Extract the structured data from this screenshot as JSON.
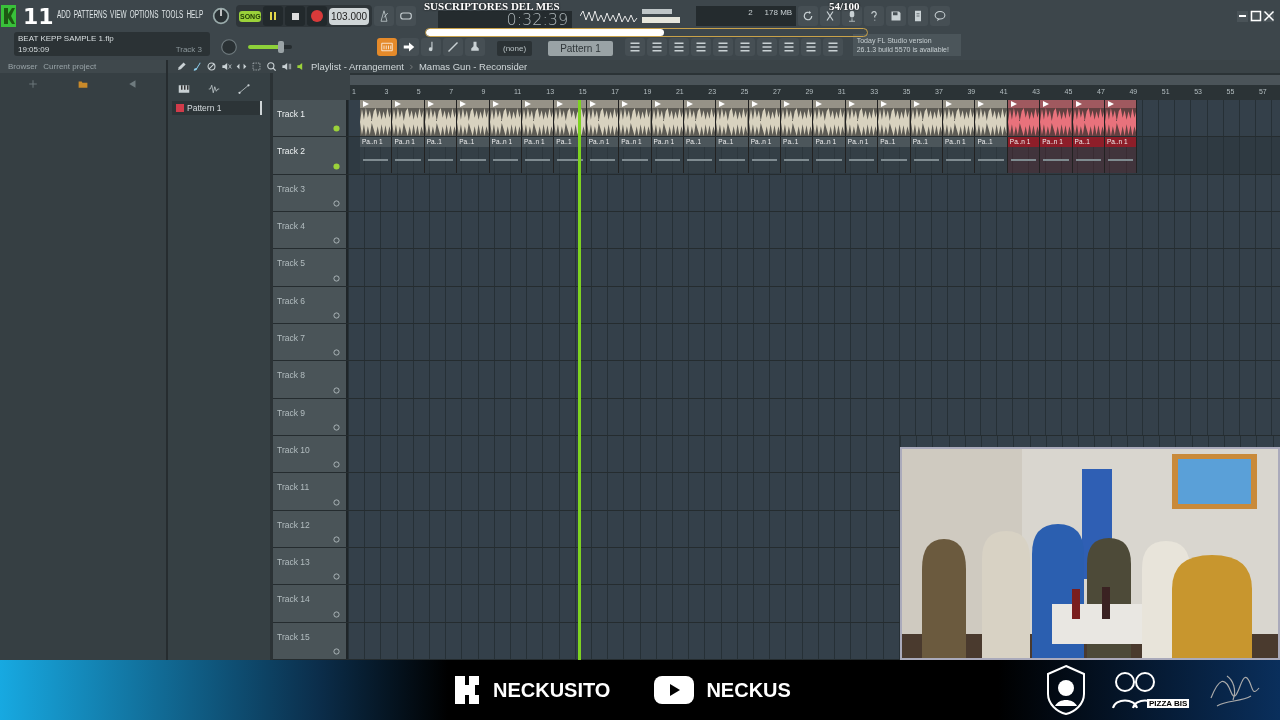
{
  "menu": {
    "badge": "11",
    "items": [
      "ADD",
      "PATTERNS",
      "VIEW",
      "OPTIONS",
      "TOOLS",
      "HELP"
    ]
  },
  "transport": {
    "song_mode": true,
    "mode_label": "SONG",
    "tempo": "103.000",
    "time": "0:32:39",
    "cpu": "2",
    "memory": "178 MB"
  },
  "subscriber_goal": {
    "title": "SUSCRIPTORES DEL MES",
    "count": "54/100",
    "level": 0.54
  },
  "project": {
    "file": "BEAT KEPP SAMPLE 1.flp",
    "time": "19:05:09",
    "hint": "Track 3"
  },
  "master_volume": {
    "level": 0.75
  },
  "pattern_selector": {
    "channel": "(none)",
    "pattern": "Pattern 1"
  },
  "news": {
    "lines": [
      "Today  FL Studio version",
      "26.1.3 build 5570 is available!"
    ]
  },
  "browser": {
    "tabs": [
      "Browser",
      "Current project"
    ]
  },
  "picker": {
    "items": [
      {
        "label": "Pattern 1",
        "selected": true
      }
    ]
  },
  "playlist": {
    "breadcrumb": [
      "Playlist - Arrangement",
      "Mamas Gun - Reconsider"
    ],
    "ruler": [
      "1",
      "3",
      "5",
      "7",
      "9",
      "11",
      "13",
      "15",
      "17",
      "19",
      "21",
      "23",
      "25",
      "27",
      "29",
      "31",
      "33",
      "35",
      "37",
      "39",
      "41",
      "43",
      "45",
      "47",
      "49",
      "51",
      "53",
      "55",
      "57"
    ],
    "playhead": {
      "level": 0.243
    },
    "tracks": [
      {
        "name": "Track 1",
        "kind": "audio",
        "clips": [
          {
            "color": "#d8d2bf"
          },
          {
            "color": "#d8d2bf"
          },
          {
            "color": "#d8d2bf"
          },
          {
            "color": "#d8d2bf"
          },
          {
            "color": "#d8d2bf"
          },
          {
            "color": "#d8d2bf"
          },
          {
            "color": "#d8d2bf"
          },
          {
            "color": "#d8d2bf"
          },
          {
            "color": "#d8d2bf"
          },
          {
            "color": "#d8d2bf"
          },
          {
            "color": "#d8d2bf"
          },
          {
            "color": "#d8d2bf"
          },
          {
            "color": "#d8d2bf"
          },
          {
            "color": "#d8d2bf"
          },
          {
            "color": "#d8d2bf"
          },
          {
            "color": "#d8d2bf"
          },
          {
            "color": "#d8d2bf"
          },
          {
            "color": "#d8d2bf"
          },
          {
            "color": "#d8d2bf"
          },
          {
            "color": "#d8d2bf"
          },
          {
            "color": "#e8727c"
          },
          {
            "color": "#e8727c"
          },
          {
            "color": "#e8727c"
          },
          {
            "color": "#e8727c"
          }
        ]
      },
      {
        "name": "Track 2",
        "kind": "pattern",
        "clips": [
          {
            "label": "Pa..n 1",
            "color": "#4c565b"
          },
          {
            "label": "Pa..n 1",
            "color": "#4c565b"
          },
          {
            "label": "Pa..1",
            "color": "#4c565b"
          },
          {
            "label": "Pa..1",
            "color": "#4c565b"
          },
          {
            "label": "Pa..n 1",
            "color": "#4c565b"
          },
          {
            "label": "Pa..n 1",
            "color": "#4c565b"
          },
          {
            "label": "Pa..1",
            "color": "#4c565b"
          },
          {
            "label": "Pa..n 1",
            "color": "#4c565b"
          },
          {
            "label": "Pa..n 1",
            "color": "#4c565b"
          },
          {
            "label": "Pa..n 1",
            "color": "#4c565b"
          },
          {
            "label": "Pa..1",
            "color": "#4c565b"
          },
          {
            "label": "Pa..1",
            "color": "#4c565b"
          },
          {
            "label": "Pa..n 1",
            "color": "#4c565b"
          },
          {
            "label": "Pa..1",
            "color": "#4c565b"
          },
          {
            "label": "Pa..n 1",
            "color": "#4c565b"
          },
          {
            "label": "Pa..n 1",
            "color": "#4c565b"
          },
          {
            "label": "Pa..1",
            "color": "#4c565b"
          },
          {
            "label": "Pa..1",
            "color": "#4c565b"
          },
          {
            "label": "Pa..n 1",
            "color": "#4c565b"
          },
          {
            "label": "Pa..1",
            "color": "#4c565b"
          },
          {
            "label": "Pa..n 1",
            "color": "#8e1e29"
          },
          {
            "label": "Pa..n 1",
            "color": "#8e1e29"
          },
          {
            "label": "Pa..1",
            "color": "#8e1e29"
          },
          {
            "label": "Pa..n 1",
            "color": "#8e1e29"
          }
        ]
      },
      {
        "name": "Track 3",
        "kind": "empty"
      },
      {
        "name": "Track 4",
        "kind": "empty"
      },
      {
        "name": "Track 5",
        "kind": "empty"
      },
      {
        "name": "Track 6",
        "kind": "empty"
      },
      {
        "name": "Track 7",
        "kind": "empty"
      },
      {
        "name": "Track 8",
        "kind": "empty"
      },
      {
        "name": "Track 9",
        "kind": "empty"
      },
      {
        "name": "Track 10",
        "kind": "empty"
      },
      {
        "name": "Track 11",
        "kind": "empty"
      },
      {
        "name": "Track 12",
        "kind": "empty"
      },
      {
        "name": "Track 13",
        "kind": "empty"
      },
      {
        "name": "Track 14",
        "kind": "empty"
      },
      {
        "name": "Track 15",
        "kind": "empty"
      }
    ]
  },
  "footer": {
    "channels": [
      {
        "kind": "kick",
        "name": "NECKUSITO"
      },
      {
        "kind": "youtube",
        "name": "NECKUS"
      }
    ],
    "sponsor": "PIZZA BIS"
  }
}
